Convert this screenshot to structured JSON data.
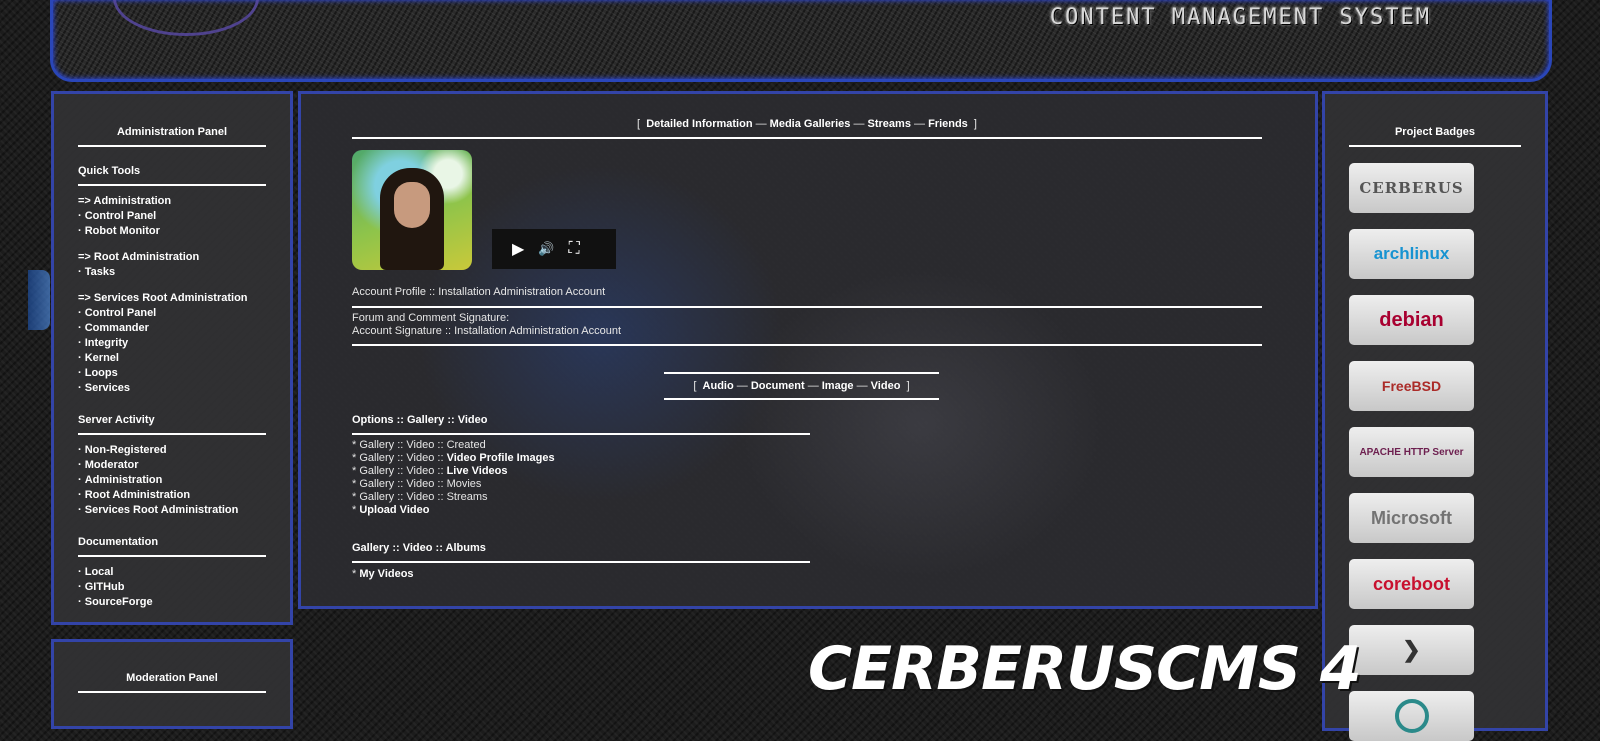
{
  "banner": {
    "title": "CONTENT MANAGEMENT SYSTEM"
  },
  "admin_panel": {
    "title": "Administration Panel",
    "quick_tools": "Quick Tools",
    "groups": [
      {
        "header": "=> Administration",
        "items": [
          "Control Panel",
          "Robot Monitor"
        ]
      },
      {
        "header": "=> Root Administration",
        "items": [
          "Tasks"
        ]
      },
      {
        "header": "=> Services Root Administration",
        "items": [
          "Control Panel",
          "Commander",
          "Integrity",
          "Kernel",
          "Loops",
          "Services"
        ]
      }
    ],
    "server_activity": "Server Activity",
    "activity_items": [
      "Non-Registered",
      "Moderator",
      "Administration",
      "Root Administration",
      "Services Root Administration"
    ],
    "documentation": "Documentation",
    "doc_items": [
      "Local",
      "GITHub",
      "SourceForge"
    ],
    "bullet": "·"
  },
  "moderation_panel": {
    "title": "Moderation Panel"
  },
  "main": {
    "nav": {
      "open": "[",
      "close": "]",
      "sep": "—",
      "items": [
        "Detailed Information",
        "Media Galleries",
        "Streams",
        "Friends"
      ]
    },
    "profile_line": "Account Profile :: Installation Administration Account",
    "signature_label": "Forum and Comment Signature:",
    "signature_value": "Account Signature :: Installation Administration Account",
    "subnav": {
      "items": [
        "Audio",
        "Document",
        "Image",
        "Video"
      ]
    },
    "options_title": "Options :: Gallery :: Video",
    "options": [
      {
        "prefix": "* Gallery :: Video :: Created",
        "link": ""
      },
      {
        "prefix": "* Gallery :: Video :: ",
        "link": "Video Profile Images"
      },
      {
        "prefix": "* Gallery :: Video :: ",
        "link": "Live Videos"
      },
      {
        "prefix": "* Gallery :: Video :: Movies",
        "link": ""
      },
      {
        "prefix": "* Gallery :: Video :: Streams",
        "link": ""
      },
      {
        "prefix": "* ",
        "link": "Upload Video"
      }
    ],
    "albums_title": "Gallery :: Video :: Albums",
    "albums": [
      {
        "prefix": "* ",
        "link": "My Videos"
      }
    ],
    "player": {
      "play_icon": "▶",
      "volume_icon": "🔊",
      "fullscreen_icon": "⛶"
    }
  },
  "badges": {
    "title": "Project Badges",
    "items": [
      {
        "label": "CERBERUS",
        "color": "#555555"
      },
      {
        "label": "archlinux",
        "color": "#1793d1"
      },
      {
        "label": "debian",
        "color": "#a80030"
      },
      {
        "label": "FreeBSD",
        "color": "#ab2b28"
      },
      {
        "label": "APACHE HTTP Server",
        "color": "#6d1f4f"
      },
      {
        "label": "Microsoft",
        "color": "#737373"
      },
      {
        "label": "coreboot",
        "color": "#c8102e"
      },
      {
        "label": "",
        "color": "#4285f4"
      },
      {
        "label": "",
        "color": "#2b8a8a"
      }
    ]
  },
  "footer": {
    "title": "CERBERUSCMS 4"
  }
}
